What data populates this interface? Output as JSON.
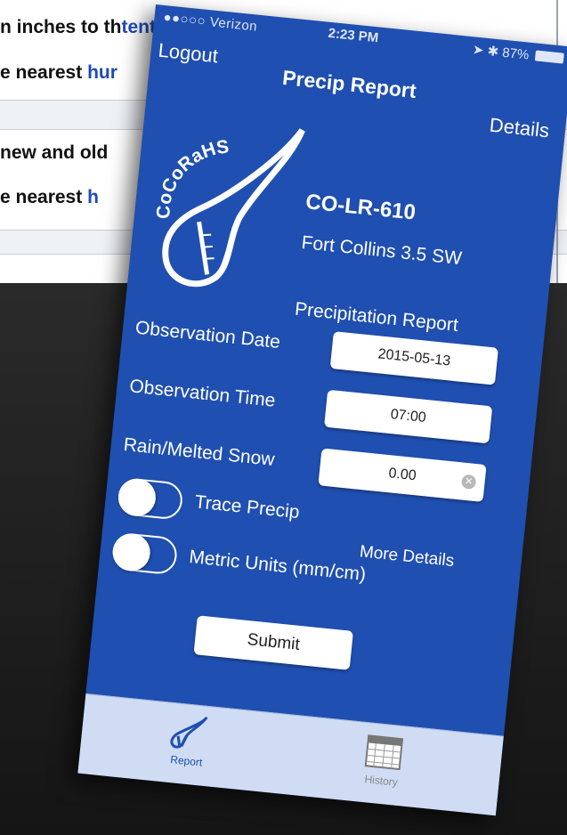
{
  "background_page": {
    "line1_prefix": "n inches to th",
    "line1_link": "tenth",
    "line2_prefix": "e nearest ",
    "line2_link": "hur",
    "line3_prefix": "new and old",
    "line4_prefix": "e nearest ",
    "line4_link": "h"
  },
  "status_bar": {
    "carrier": "●●○○○ Verizon",
    "time": "2:23 PM",
    "battery": "87%"
  },
  "nav": {
    "logout_label": "Logout",
    "title": "Precip Report",
    "details_label": "Details"
  },
  "logo": {
    "text": "CoCoRaHS"
  },
  "station": {
    "id": "CO-LR-610",
    "name": "Fort Collins 3.5 SW"
  },
  "form": {
    "section_title": "Precipitation Report",
    "observation_date_label": "Observation Date",
    "observation_date_value": "2015-05-13",
    "observation_time_label": "Observation Time",
    "observation_time_value": "07:00",
    "rain_label": "Rain/Melted Snow",
    "rain_value": "0.00",
    "trace_precip_label": "Trace Precip",
    "trace_precip_on": false,
    "more_details_label": "More Details",
    "metric_units_label": "Metric Units (mm/cm)",
    "metric_units_on": false,
    "submit_label": "Submit"
  },
  "tabbar": {
    "tabs": [
      {
        "label": "Report",
        "icon": "raindrop-icon",
        "active": true
      },
      {
        "label": "History",
        "icon": "calendar-icon",
        "active": false
      }
    ]
  },
  "colors": {
    "app_blue": "#1f4fb0",
    "tabbar_bg": "#cfdcf3",
    "link_blue": "#1f49b8"
  }
}
